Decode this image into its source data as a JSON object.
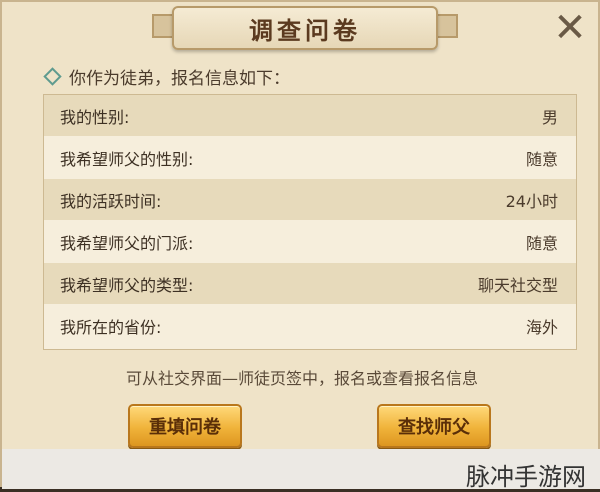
{
  "dialog": {
    "title": "调查问卷",
    "close_glyph": "✕",
    "intro": "你作为徒弟，报名信息如下："
  },
  "fields": [
    {
      "label": "我的性别:",
      "value": "男"
    },
    {
      "label": "我希望师父的性别:",
      "value": "随意"
    },
    {
      "label": "我的活跃时间:",
      "value": "24小时"
    },
    {
      "label": "我希望师父的门派:",
      "value": "随意"
    },
    {
      "label": "我希望师父的类型:",
      "value": "聊天社交型"
    },
    {
      "label": "我所在的省份:",
      "value": "海外"
    }
  ],
  "hint": "可从社交界面—师徒页签中，报名或查看报名信息",
  "buttons": {
    "refill": "重填问卷",
    "find_master": "查找师父"
  },
  "watermark": "脉冲手游网",
  "colors": {
    "panel_bg": "#efe3c8",
    "button_gold": "#f0b33a",
    "title_brown": "#5b3a1f"
  }
}
